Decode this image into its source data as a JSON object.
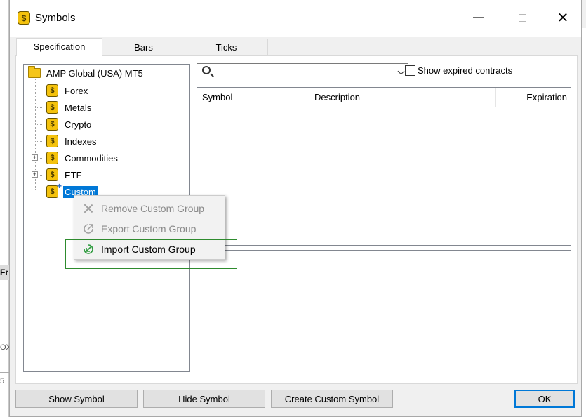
{
  "window": {
    "title": "Symbols"
  },
  "background": {
    "label_fr": "Fr",
    "label_ox": "OX",
    "label_5": "5"
  },
  "tabs": [
    {
      "label": "Specification"
    },
    {
      "label": "Bars"
    },
    {
      "label": "Ticks"
    }
  ],
  "tree": {
    "root": "AMP Global (USA) MT5",
    "items": [
      {
        "label": "Forex"
      },
      {
        "label": "Metals"
      },
      {
        "label": "Crypto"
      },
      {
        "label": "Indexes"
      },
      {
        "label": "Commodities"
      },
      {
        "label": "ETF"
      },
      {
        "label": "Custom"
      }
    ]
  },
  "search": {
    "value": "",
    "placeholder": ""
  },
  "show_expired": {
    "label": "Show expired contracts",
    "checked": false
  },
  "table": {
    "columns": [
      "Symbol",
      "Description",
      "Expiration"
    ],
    "rows": []
  },
  "context_menu": {
    "items": [
      {
        "label": "Remove Custom Group",
        "enabled": false
      },
      {
        "label": "Export Custom Group",
        "enabled": false
      },
      {
        "label": "Import Custom Group",
        "enabled": true
      }
    ]
  },
  "buttons": {
    "show_symbol": "Show Symbol",
    "hide_symbol": "Hide Symbol",
    "create_custom_symbol": "Create Custom Symbol",
    "ok": "OK"
  },
  "colors": {
    "selection": "#0078d7",
    "symbol_icon": "#f4c20d",
    "highlight_frame": "#2e8b2e",
    "import_icon": "#2e9b3e"
  },
  "icons": {
    "app": "dollar-coin-icon",
    "symbol_group": "dollar-coin-icon",
    "remove": "x-icon",
    "export": "export-arrow-icon",
    "import": "import-arrow-icon"
  }
}
